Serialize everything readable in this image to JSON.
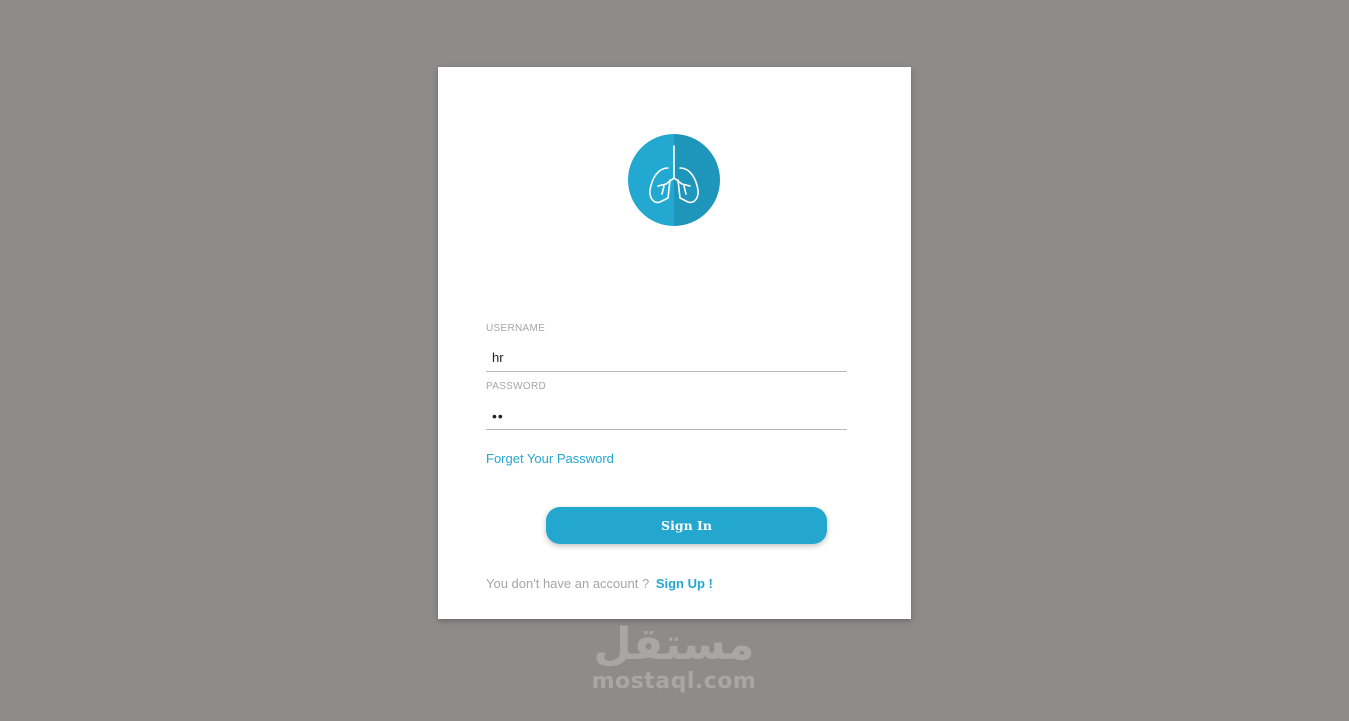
{
  "login": {
    "logo_icon": "lungs-icon",
    "username": {
      "label": "USERNAME",
      "value": "hr"
    },
    "password": {
      "label": "PASSWORD",
      "value": "••"
    },
    "forgot_link": "Forget Your Password",
    "signin_button": "Sign In",
    "signup_prompt": "You don't have an account ?",
    "signup_link": "Sign Up !"
  },
  "watermark": {
    "arabic": "مستقل",
    "latin": "mostaql.com"
  },
  "colors": {
    "background": "#8f8b8a",
    "card": "#ffffff",
    "accent": "#23a7cf",
    "muted_text": "#a6a6a6"
  }
}
